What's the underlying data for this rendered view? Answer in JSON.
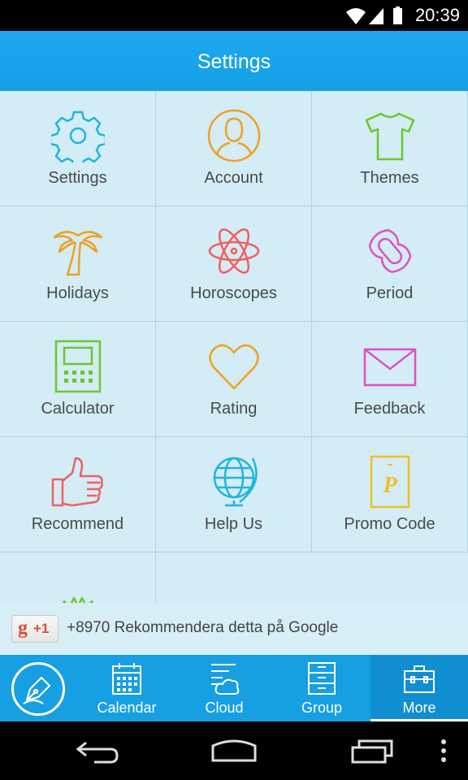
{
  "status_bar": {
    "time": "20:39",
    "icons": [
      "wifi-icon",
      "signal-icon",
      "battery-icon"
    ]
  },
  "header": {
    "title": "Settings"
  },
  "colors": {
    "header_blue": "#1ea7ee",
    "tile_bg": "#d3ecf5",
    "cyan": "#1fb5e0",
    "orange": "#f0a020",
    "green": "#6cc82a",
    "red": "#f06060",
    "pink": "#e050c0",
    "yellow": "#f0c020"
  },
  "grid": {
    "tiles": [
      {
        "label": "Settings",
        "icon": "gear-icon"
      },
      {
        "label": "Account",
        "icon": "person-icon"
      },
      {
        "label": "Themes",
        "icon": "tshirt-icon"
      },
      {
        "label": "Holidays",
        "icon": "palm-tree-icon"
      },
      {
        "label": "Horoscopes",
        "icon": "atom-icon"
      },
      {
        "label": "Period",
        "icon": "pad-icon"
      },
      {
        "label": "Calculator",
        "icon": "calculator-icon"
      },
      {
        "label": "Rating",
        "icon": "heart-icon"
      },
      {
        "label": "Feedback",
        "icon": "envelope-icon"
      },
      {
        "label": "Recommend",
        "icon": "thumbs-up-icon"
      },
      {
        "label": "Help Us",
        "icon": "globe-icon"
      },
      {
        "label": "Promo Code",
        "icon": "promo-card-icon"
      },
      {
        "label": "",
        "icon": "vip-badge-icon"
      }
    ]
  },
  "gplus": {
    "button_g": "g",
    "button_plus": "+1",
    "text": "+8970 Rekommendera detta på Google"
  },
  "tab_bar": {
    "compose_icon": "pen-icon",
    "tabs": [
      {
        "label": "Calendar",
        "icon": "calendar-icon",
        "active": false
      },
      {
        "label": "Cloud",
        "icon": "cloud-list-icon",
        "active": false
      },
      {
        "label": "Group",
        "icon": "cabinet-icon",
        "active": false
      },
      {
        "label": "More",
        "icon": "toolbox-icon",
        "active": true
      }
    ]
  },
  "nav_bar": {
    "icons": [
      "back-icon",
      "home-icon",
      "recents-icon",
      "menu-icon"
    ]
  }
}
